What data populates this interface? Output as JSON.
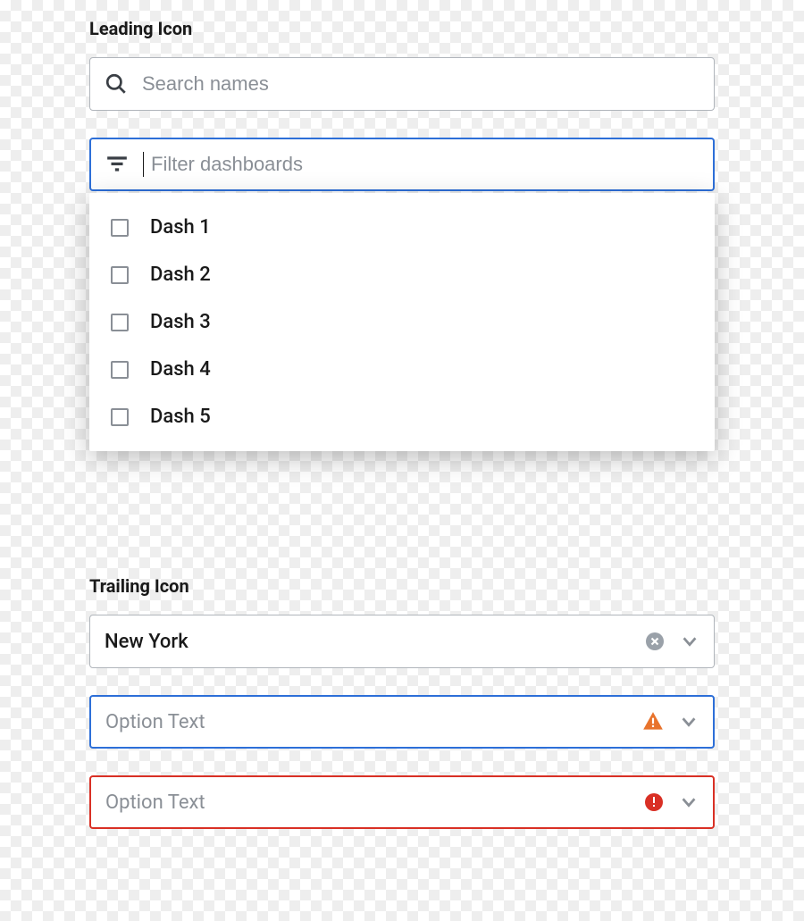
{
  "section1": {
    "label": "Leading Icon",
    "search": {
      "placeholder": "Search names"
    },
    "filter": {
      "placeholder": "Filter dashboards",
      "options": [
        "Dash 1",
        "Dash 2",
        "Dash 3",
        "Dash 4",
        "Dash 5"
      ]
    }
  },
  "section2": {
    "label": "Trailing Icon",
    "field1": {
      "value": "New York"
    },
    "field2": {
      "placeholder": "Option Text"
    },
    "field3": {
      "placeholder": "Option Text"
    }
  }
}
